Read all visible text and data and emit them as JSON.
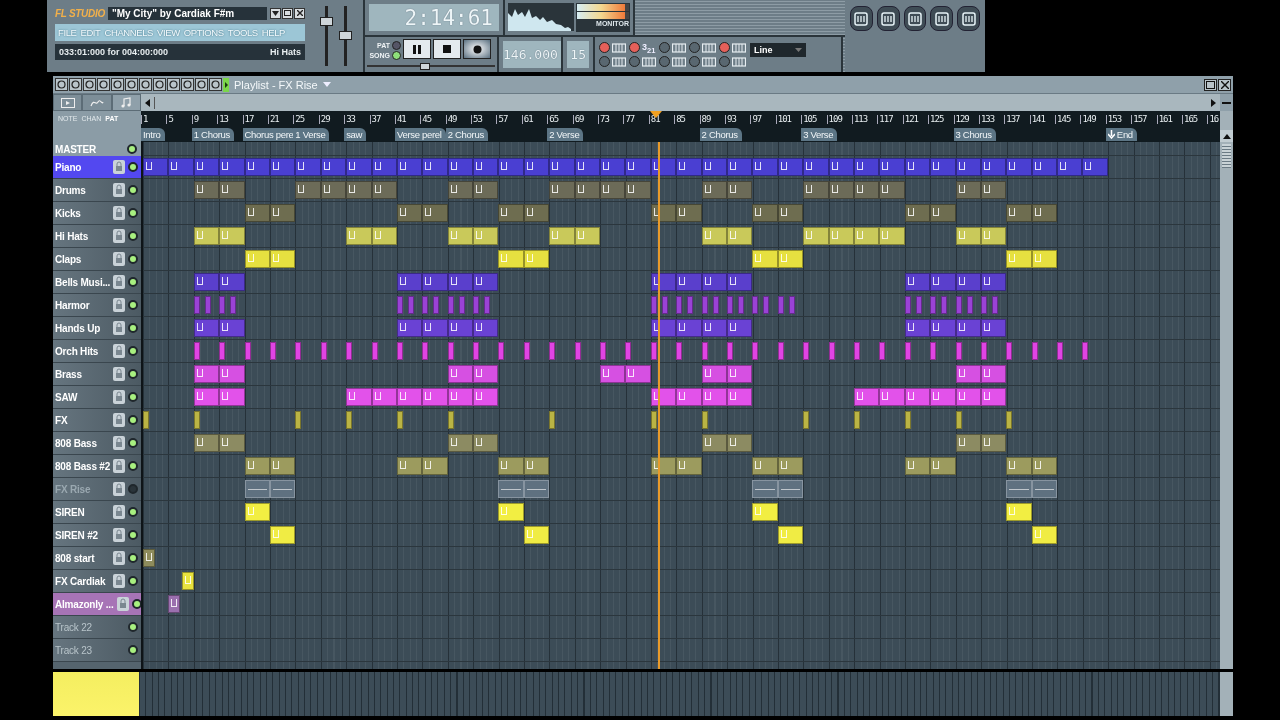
{
  "app": {
    "logo": "FL STUDIO",
    "title": "\"My City\" by Cardiak F#m",
    "menu": [
      "FILE",
      "EDIT",
      "CHANNELS",
      "VIEW",
      "OPTIONS",
      "TOOLS",
      "HELP"
    ],
    "hint": "033:01:000 for 004:00:000",
    "hint_target": "Hi Hats"
  },
  "sliders": [
    {
      "level": 0.78
    },
    {
      "level": 0.5
    }
  ],
  "transport": {
    "time": "2:14:61",
    "mode": [
      {
        "label": "PAT",
        "selected": false
      },
      {
        "label": "SONG",
        "selected": true
      }
    ],
    "tempo": "146.000",
    "pattern": "15",
    "position": {
      "level": 0.45
    }
  },
  "monitor": {
    "label": "MONITOR",
    "meters": [
      {
        "level": 0.93
      },
      {
        "level": 0.93
      }
    ]
  },
  "options": [
    {
      "kind": "icon",
      "on": true
    },
    {
      "kind": "text",
      "label": "3$_{2}$$_{1}$",
      "on": true
    },
    {
      "kind": "icon",
      "on": false
    },
    {
      "kind": "icon",
      "on": false
    },
    {
      "kind": "icon",
      "on": true
    },
    {
      "kind": "icon",
      "on": false
    },
    {
      "kind": "icon",
      "on": false
    },
    {
      "kind": "icon",
      "on": false
    },
    {
      "kind": "icon",
      "on": false
    },
    {
      "kind": "icon",
      "on": false
    }
  ],
  "snap": {
    "value": "Line"
  },
  "playlist": {
    "title": "Playlist - FX Rise",
    "panel_labels": [
      {
        "label": "NOTE",
        "selected": false
      },
      {
        "label": "CHAN",
        "selected": false
      },
      {
        "label": "PAT",
        "selected": true
      }
    ],
    "ticks": [
      {
        "label": "1",
        "playhead": false,
        "marker": {
          "text": "Intro",
          "kind": "section"
        }
      },
      {
        "label": "5",
        "playhead": false
      },
      {
        "label": "9",
        "playhead": false,
        "marker": {
          "text": "1 Chorus",
          "kind": "section"
        }
      },
      {
        "label": "13",
        "playhead": false
      },
      {
        "label": "17",
        "playhead": false,
        "marker": {
          "text": "Chorus pere",
          "kind": "section"
        }
      },
      {
        "label": "21",
        "playhead": false
      },
      {
        "label": "25",
        "playhead": false,
        "marker": {
          "text": "1 Verse",
          "kind": "section"
        }
      },
      {
        "label": "29",
        "playhead": false
      },
      {
        "label": "33",
        "playhead": false,
        "marker": {
          "text": "saw",
          "kind": "section"
        }
      },
      {
        "label": "37",
        "playhead": false
      },
      {
        "label": "41",
        "playhead": false,
        "marker": {
          "text": "Verse perel",
          "kind": "section"
        }
      },
      {
        "label": "45",
        "playhead": false
      },
      {
        "label": "49",
        "playhead": false,
        "marker": {
          "text": "2 Chorus",
          "kind": "section"
        }
      },
      {
        "label": "53",
        "playhead": false
      },
      {
        "label": "57",
        "playhead": false
      },
      {
        "label": "61",
        "playhead": false
      },
      {
        "label": "65",
        "playhead": false,
        "marker": {
          "text": "2 Verse",
          "kind": "section"
        }
      },
      {
        "label": "69",
        "playhead": false
      },
      {
        "label": "73",
        "playhead": false
      },
      {
        "label": "77",
        "playhead": false
      },
      {
        "label": "81",
        "playhead": true
      },
      {
        "label": "85",
        "playhead": false
      },
      {
        "label": "89",
        "playhead": false,
        "marker": {
          "text": "2 Chorus",
          "kind": "section"
        }
      },
      {
        "label": "93",
        "playhead": false
      },
      {
        "label": "97",
        "playhead": false
      },
      {
        "label": "101",
        "playhead": false
      },
      {
        "label": "105",
        "playhead": false,
        "marker": {
          "text": "3 Verse",
          "kind": "section"
        }
      },
      {
        "label": "109",
        "playhead": false
      },
      {
        "label": "113",
        "playhead": false
      },
      {
        "label": "117",
        "playhead": false
      },
      {
        "label": "121",
        "playhead": false
      },
      {
        "label": "125",
        "playhead": false
      },
      {
        "label": "129",
        "playhead": false,
        "marker": {
          "text": "3 Chorus",
          "kind": "section"
        }
      },
      {
        "label": "133",
        "playhead": false
      },
      {
        "label": "137",
        "playhead": false
      },
      {
        "label": "141",
        "playhead": false
      },
      {
        "label": "145",
        "playhead": false
      },
      {
        "label": "149",
        "playhead": false
      },
      {
        "label": "153",
        "playhead": false,
        "marker": {
          "text": "End",
          "kind": "end"
        }
      },
      {
        "label": "157",
        "playhead": false
      },
      {
        "label": "161",
        "playhead": false
      },
      {
        "label": "165",
        "playhead": false
      },
      {
        "label": "16",
        "playhead": false
      }
    ],
    "master": "MASTER",
    "tracks": [
      {
        "name": "Piano",
        "kind": "pattern",
        "selected": true,
        "muted": false,
        "color": "#4a3fd2",
        "clips": {
          "kind": "block",
          "slots": [
            true,
            true,
            true,
            true,
            true,
            true,
            true,
            true,
            true,
            true,
            true,
            true,
            true,
            true,
            true,
            true,
            true,
            true,
            true,
            true,
            true,
            true,
            true,
            true,
            true,
            true,
            true,
            true,
            true,
            true,
            true,
            true,
            true,
            true,
            true,
            true,
            true,
            true
          ]
        }
      },
      {
        "name": "Drums",
        "kind": "pattern",
        "selected": false,
        "muted": false,
        "color": "#6c6b58",
        "clips": {
          "kind": "block",
          "slots": [
            false,
            false,
            true,
            true,
            false,
            false,
            true,
            true,
            true,
            true,
            false,
            false,
            true,
            true,
            false,
            false,
            true,
            true,
            true,
            true,
            false,
            false,
            true,
            true,
            false,
            false,
            true,
            true,
            true,
            true,
            false,
            false,
            true,
            true
          ]
        }
      },
      {
        "name": "Kicks",
        "kind": "pattern",
        "selected": false,
        "muted": false,
        "color": "#6e6d50",
        "clips": {
          "kind": "block",
          "slots": [
            false,
            false,
            false,
            false,
            true,
            true,
            false,
            false,
            false,
            false,
            true,
            true,
            false,
            false,
            true,
            true,
            false,
            false,
            false,
            false,
            true,
            true,
            false,
            false,
            true,
            true,
            false,
            false,
            false,
            false,
            true,
            true,
            false,
            false,
            true,
            true
          ]
        }
      },
      {
        "name": "Hi Hats",
        "kind": "pattern",
        "selected": false,
        "muted": false,
        "color": "#c9c95a",
        "clips": {
          "kind": "block",
          "slots": [
            false,
            false,
            true,
            true,
            false,
            false,
            false,
            false,
            true,
            true,
            false,
            false,
            true,
            true,
            false,
            false,
            true,
            true,
            false,
            false,
            false,
            false,
            true,
            true,
            false,
            false,
            true,
            true,
            true,
            true,
            false,
            false,
            true,
            true
          ]
        }
      },
      {
        "name": "Claps",
        "kind": "pattern",
        "selected": false,
        "muted": false,
        "color": "#e6e040",
        "clips": {
          "kind": "block",
          "slots": [
            false,
            false,
            false,
            false,
            true,
            true,
            false,
            false,
            false,
            false,
            false,
            false,
            false,
            false,
            true,
            true,
            false,
            false,
            false,
            false,
            false,
            false,
            false,
            false,
            true,
            true,
            false,
            false,
            false,
            false,
            false,
            false,
            false,
            false,
            true,
            true
          ]
        }
      },
      {
        "name": "Bells Musi...",
        "kind": "pattern",
        "selected": false,
        "muted": false,
        "color": "#5a3fcc",
        "clips": {
          "kind": "block",
          "slots": [
            false,
            false,
            true,
            true,
            false,
            false,
            false,
            false,
            false,
            false,
            true,
            true,
            true,
            true,
            false,
            false,
            false,
            false,
            false,
            false,
            true,
            true,
            true,
            true,
            false,
            false,
            false,
            false,
            false,
            false,
            true,
            true,
            true,
            true
          ]
        }
      },
      {
        "name": "Harmor",
        "kind": "pattern",
        "selected": false,
        "muted": false,
        "color": "#9a42d6",
        "clips": {
          "kind": "pair",
          "slots": [
            false,
            false,
            true,
            true,
            false,
            false,
            false,
            false,
            false,
            false,
            true,
            true,
            true,
            true,
            false,
            false,
            false,
            false,
            false,
            false,
            true,
            true,
            true,
            true,
            true,
            true,
            false,
            false,
            false,
            false,
            true,
            true,
            true,
            true
          ]
        }
      },
      {
        "name": "Hands Up",
        "kind": "pattern",
        "selected": false,
        "muted": false,
        "color": "#6a42d4",
        "clips": {
          "kind": "block",
          "slots": [
            false,
            false,
            true,
            true,
            false,
            false,
            false,
            false,
            false,
            false,
            true,
            true,
            true,
            true,
            false,
            false,
            false,
            false,
            false,
            false,
            true,
            true,
            true,
            true,
            false,
            false,
            false,
            false,
            false,
            false,
            true,
            true,
            true,
            true
          ]
        }
      },
      {
        "name": "Orch Hits",
        "kind": "pattern",
        "selected": false,
        "muted": false,
        "color": "#e044e4",
        "clips": {
          "kind": "hit",
          "slots": [
            false,
            false,
            true,
            true,
            true,
            true,
            true,
            true,
            true,
            true,
            true,
            true,
            true,
            true,
            true,
            true,
            true,
            true,
            true,
            true,
            true,
            true,
            true,
            true,
            true,
            true,
            true,
            true,
            true,
            true,
            true,
            true,
            true,
            true,
            true,
            true,
            true,
            true
          ]
        }
      },
      {
        "name": "Brass",
        "kind": "pattern",
        "selected": false,
        "muted": false,
        "color": "#d650e2",
        "clips": {
          "kind": "block",
          "slots": [
            false,
            false,
            true,
            true,
            false,
            false,
            false,
            false,
            false,
            false,
            false,
            false,
            true,
            true,
            false,
            false,
            false,
            false,
            true,
            true,
            false,
            false,
            true,
            true,
            false,
            false,
            false,
            false,
            false,
            false,
            false,
            false,
            true,
            true
          ]
        }
      },
      {
        "name": "SAW",
        "kind": "pattern",
        "selected": false,
        "muted": false,
        "color": "#e252ea",
        "clips": {
          "kind": "block",
          "slots": [
            false,
            false,
            true,
            true,
            false,
            false,
            false,
            false,
            true,
            true,
            true,
            true,
            true,
            true,
            false,
            false,
            false,
            false,
            false,
            false,
            true,
            true,
            true,
            true,
            false,
            false,
            false,
            false,
            true,
            true,
            true,
            true,
            true,
            true
          ]
        }
      },
      {
        "name": "FX",
        "kind": "pattern",
        "selected": false,
        "muted": false,
        "color": "#bab444",
        "clips": {
          "kind": "hit",
          "slots": [
            true,
            false,
            true,
            false,
            false,
            false,
            true,
            false,
            true,
            false,
            true,
            false,
            true,
            false,
            false,
            false,
            true,
            false,
            false,
            false,
            true,
            false,
            true,
            false,
            false,
            false,
            true,
            false,
            true,
            false,
            true,
            false,
            true,
            false,
            true
          ]
        }
      },
      {
        "name": "808 Bass",
        "kind": "pattern",
        "selected": false,
        "muted": false,
        "color": "#8c8b62",
        "clips": {
          "kind": "block",
          "slots": [
            false,
            false,
            true,
            true,
            false,
            false,
            false,
            false,
            false,
            false,
            false,
            false,
            true,
            true,
            false,
            false,
            false,
            false,
            false,
            false,
            false,
            false,
            true,
            true,
            false,
            false,
            false,
            false,
            false,
            false,
            false,
            false,
            true,
            true
          ]
        }
      },
      {
        "name": "808 Bass #2",
        "kind": "pattern",
        "selected": false,
        "muted": false,
        "color": "#9c9b5e",
        "clips": {
          "kind": "block",
          "slots": [
            false,
            false,
            false,
            false,
            true,
            true,
            false,
            false,
            false,
            false,
            true,
            true,
            false,
            false,
            true,
            true,
            false,
            false,
            false,
            false,
            true,
            true,
            false,
            false,
            true,
            true,
            false,
            false,
            false,
            false,
            true,
            true,
            false,
            false,
            true,
            true
          ]
        }
      },
      {
        "name": "FX Rise",
        "kind": "pattern",
        "selected": false,
        "muted": true,
        "color": "#5f7180",
        "clips": {
          "kind": "block",
          "slots": [
            false,
            false,
            false,
            false,
            true,
            true,
            false,
            false,
            false,
            false,
            false,
            false,
            false,
            false,
            true,
            true,
            false,
            false,
            false,
            false,
            false,
            false,
            false,
            false,
            true,
            true,
            false,
            false,
            false,
            false,
            false,
            false,
            false,
            false,
            true,
            true
          ]
        }
      },
      {
        "name": "SIREN",
        "kind": "pattern",
        "selected": false,
        "muted": false,
        "color": "#f2ee42",
        "clips": {
          "kind": "block",
          "slots": [
            false,
            false,
            false,
            false,
            true,
            false,
            false,
            false,
            false,
            false,
            false,
            false,
            false,
            false,
            true,
            false,
            false,
            false,
            false,
            false,
            false,
            false,
            false,
            false,
            true,
            false,
            false,
            false,
            false,
            false,
            false,
            false,
            false,
            false,
            true
          ]
        }
      },
      {
        "name": "SIREN #2",
        "kind": "pattern",
        "selected": false,
        "muted": false,
        "color": "#f0ec44",
        "clips": {
          "kind": "block",
          "slots": [
            false,
            false,
            false,
            false,
            false,
            true,
            false,
            false,
            false,
            false,
            false,
            false,
            false,
            false,
            false,
            true,
            false,
            false,
            false,
            false,
            false,
            false,
            false,
            false,
            false,
            true,
            false,
            false,
            false,
            false,
            false,
            false,
            false,
            false,
            false,
            true
          ]
        }
      },
      {
        "name": "808 start",
        "kind": "pattern",
        "selected": false,
        "muted": false,
        "color": "#8e8c5c",
        "clips": {
          "kind": "short",
          "slots": [
            true
          ]
        }
      },
      {
        "name": "FX Cardiak",
        "kind": "pattern",
        "selected": false,
        "muted": false,
        "color": "#e8e23e",
        "clips": {
          "kind": "late",
          "slots": [
            false,
            true
          ]
        }
      },
      {
        "name": "Almazonly ...",
        "kind": "audio",
        "selected": false,
        "muted": false,
        "color": "#9a6fae",
        "clips": {
          "kind": "short",
          "slots": [
            false,
            true
          ]
        }
      },
      {
        "name": "Track 22",
        "kind": "empty",
        "selected": false,
        "muted": false
      },
      {
        "name": "Track 23",
        "kind": "empty",
        "selected": false,
        "muted": false
      }
    ]
  }
}
